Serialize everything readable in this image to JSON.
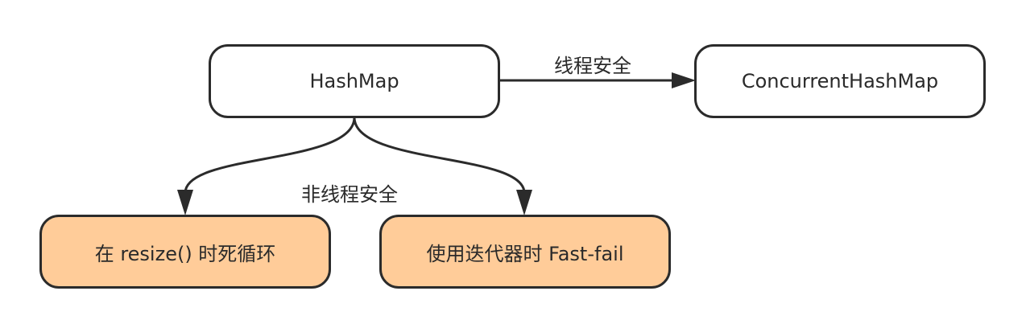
{
  "nodes": {
    "hashmap": "HashMap",
    "concurrent": "ConcurrentHashMap",
    "resize": "在 resize() 时死循环",
    "fastfail": "使用迭代器时 Fast-fail"
  },
  "edges": {
    "thread_safe": "线程安全",
    "not_thread_safe": "非线程安全"
  },
  "colors": {
    "stroke": "#2b2b2b",
    "orange_fill": "#ffcc99",
    "white_fill": "#ffffff"
  }
}
